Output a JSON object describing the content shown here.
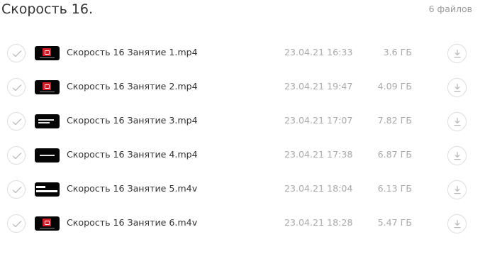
{
  "header": {
    "title": "Скорость 16.",
    "file_count": "6 файлов"
  },
  "files": [
    {
      "name": "Скорость 16 Занятие 1.mp4",
      "date": "23.04.21 16:33",
      "size": "3.6 ГБ",
      "thumb": "red-logo"
    },
    {
      "name": "Скорость 16 Занятие 2.mp4",
      "date": "23.04.21 19:47",
      "size": "4.09 ГБ",
      "thumb": "red-logo"
    },
    {
      "name": "Скорость 16 Занятие 3.mp4",
      "date": "23.04.21 17:07",
      "size": "7.82 ГБ",
      "thumb": "text-lines"
    },
    {
      "name": "Скорость 16 Занятие 4.mp4",
      "date": "23.04.21 17:38",
      "size": "6.87 ГБ",
      "thumb": "center-text"
    },
    {
      "name": "Скорость 16 Занятие 5.m4v",
      "date": "23.04.21 18:04",
      "size": "6.13 ГБ",
      "thumb": "bold-text"
    },
    {
      "name": "Скорость 16 Занятие 6.m4v",
      "date": "23.04.21 18:28",
      "size": "5.47 ГБ",
      "thumb": "red-logo"
    }
  ],
  "icons": {
    "select": "check-icon",
    "download": "download-icon"
  },
  "colors": {
    "primary_text": "#333333",
    "secondary_text": "#aaaaaa",
    "border": "#dddddd",
    "thumbnail_bg": "#050505",
    "logo_red": "#d11d24"
  }
}
